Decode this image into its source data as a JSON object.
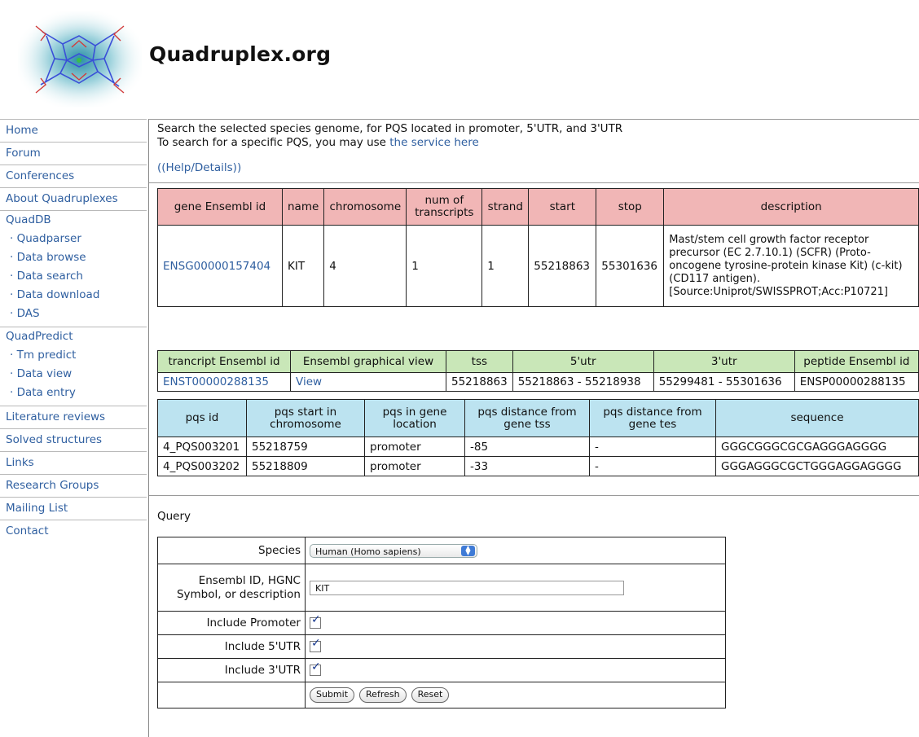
{
  "site": {
    "title": "Quadruplex.org"
  },
  "nav": {
    "items_top": [
      "Home",
      "Forum",
      "Conferences",
      "About Quadruplexes"
    ],
    "quaddb": {
      "title": "QuadDB",
      "items": [
        "· Quadparser",
        "· Data browse",
        "· Data search",
        "· Data download",
        "· DAS"
      ]
    },
    "quadpredict": {
      "title": "QuadPredict",
      "items": [
        "· Tm predict",
        "· Data view",
        "· Data entry"
      ]
    },
    "items_bottom": [
      "Literature reviews",
      "Solved structures",
      "Links",
      "Research Groups",
      "Mailing List",
      "Contact"
    ]
  },
  "intro": {
    "line1": "Search the selected species genome, for PQS located in promoter, 5'UTR, and 3'UTR",
    "line2_prefix": "To search for a specific PQS, you may use ",
    "line2_link": "the service here",
    "help": "(Help/Details)"
  },
  "gene_table": {
    "headers": [
      "gene Ensembl id",
      "name",
      "chromosome",
      "num of transcripts",
      "strand",
      "start",
      "stop",
      "description"
    ],
    "row": {
      "id": "ENSG00000157404",
      "name": "KIT",
      "chromosome": "4",
      "transcripts": "1",
      "strand": "1",
      "start": "55218863",
      "stop": "55301636",
      "description": "Mast/stem cell growth factor receptor precursor (EC 2.7.10.1) (SCFR) (Proto-oncogene tyrosine-protein kinase Kit) (c-kit) (CD117 antigen). [Source:Uniprot/SWISSPROT;Acc:P10721]"
    }
  },
  "transcript_table": {
    "headers": [
      "trancript Ensembl id",
      "Ensembl graphical view",
      "tss",
      "5'utr",
      "3'utr",
      "peptide Ensembl id"
    ],
    "row": {
      "id": "ENST00000288135",
      "view": "View",
      "tss": "55218863",
      "utr5": "55218863 - 55218938",
      "utr3": "55299481 - 55301636",
      "peptide": "ENSP00000288135"
    }
  },
  "pqs_table": {
    "headers": [
      "pqs id",
      "pqs start in chromosome",
      "pqs in gene location",
      "pqs distance from gene tss",
      "pqs distance from gene tes",
      "sequence"
    ],
    "rows": [
      {
        "id": "4_PQS003201",
        "start": "55218759",
        "location": "promoter",
        "dist_tss": "-85",
        "dist_tes": "-",
        "sequence": "GGGCGGGCGCGAGGGAGGGG"
      },
      {
        "id": "4_PQS003202",
        "start": "55218809",
        "location": "promoter",
        "dist_tss": "-33",
        "dist_tes": "-",
        "sequence": "GGGAGGGCGCTGGGAGGAGGGG"
      }
    ]
  },
  "query": {
    "title": "Query",
    "species_label": "Species",
    "species_value": "Human (Homo sapiens)",
    "id_label": "Ensembl ID, HGNC Symbol, or description",
    "id_value": "KIT",
    "promoter_label": "Include Promoter",
    "promoter_checked": true,
    "utr5_label": "Include 5'UTR",
    "utr5_checked": true,
    "utr3_label": "Include 3'UTR",
    "utr3_checked": true,
    "submit": "Submit",
    "refresh": "Refresh",
    "reset": "Reset"
  },
  "colors": {
    "gene_header": "#f1b6b6",
    "transcript_header": "#c9e7b8",
    "pqs_header": "#bce3f0",
    "link": "#2f5fa0"
  }
}
